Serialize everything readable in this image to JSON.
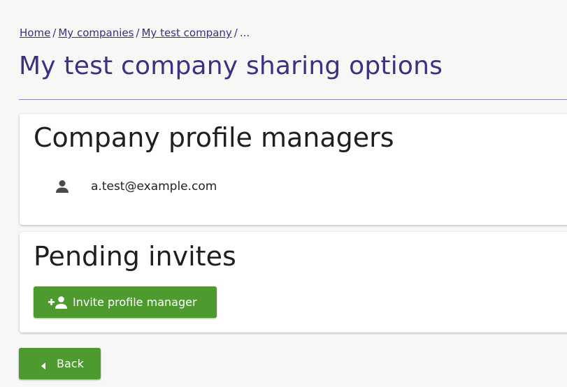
{
  "breadcrumb": {
    "home": "Home",
    "my_companies": "My companies",
    "company": "My test company",
    "separator": "/",
    "ellipsis": "..."
  },
  "page": {
    "title": "My test company sharing options"
  },
  "managers_card": {
    "heading": "Company profile managers",
    "managers": [
      {
        "icon": "person-icon",
        "email": "a.test@example.com"
      }
    ]
  },
  "invites_card": {
    "heading": "Pending invites",
    "invite_button": {
      "icon": "person-add-icon",
      "label": "Invite profile manager"
    }
  },
  "back_button": {
    "icon": "caret-left-icon",
    "label": "Back"
  },
  "colors": {
    "title": "#3f2f82",
    "link": "#3a2f7a",
    "button": "#4f9a2f",
    "divider": "#8d86c0"
  }
}
